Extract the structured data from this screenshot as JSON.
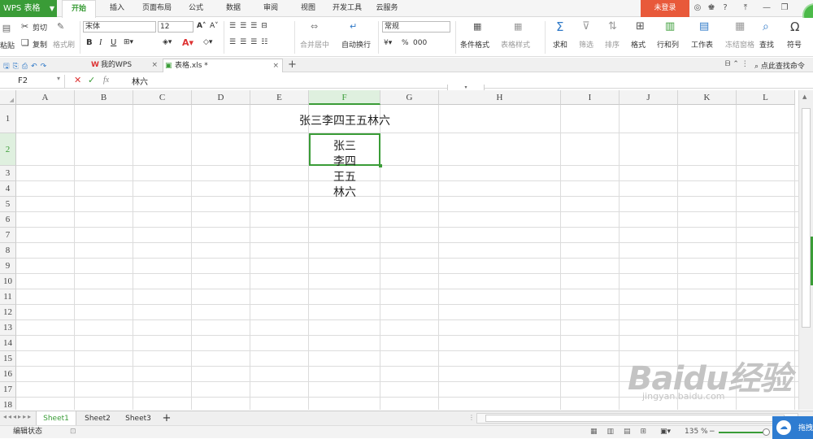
{
  "app": {
    "name": "WPS 表格"
  },
  "menu": {
    "tabs": [
      "开始",
      "插入",
      "页面布局",
      "公式",
      "数据",
      "审阅",
      "视图",
      "开发工具",
      "云服务"
    ],
    "active": "开始",
    "login": "未登录"
  },
  "ribbon": {
    "cut": "剪切",
    "copy": "复制",
    "format_painter": "格式刷",
    "paste": "粘贴",
    "font_name": "宋体",
    "font_size": "12",
    "merge_center": "合并居中",
    "wrap_text": "自动换行",
    "number_format": "常规",
    "percent": "%",
    "thousands": "000",
    "conditional_format": "条件格式",
    "table_style": "表格样式",
    "sum": "求和",
    "filter": "筛选",
    "sort": "排序",
    "format": "格式",
    "row_col": "行和列",
    "worksheet": "工作表",
    "freeze": "冻结窗格",
    "find": "查找",
    "symbol": "符号"
  },
  "doc_tabs": {
    "my_wps": "我的WPS",
    "file": "表格.xls *",
    "find_cmd": "点此查找命令"
  },
  "formula_bar": {
    "cell_ref": "F2",
    "fx": "fx",
    "value": "林六"
  },
  "columns": [
    "A",
    "B",
    "C",
    "D",
    "E",
    "F",
    "G",
    "H",
    "I",
    "J",
    "K",
    "L"
  ],
  "active_column": "F",
  "rows": [
    "1",
    "2",
    "3",
    "4",
    "5",
    "6",
    "7",
    "8",
    "9",
    "10",
    "11",
    "12",
    "13",
    "14",
    "15",
    "16",
    "17",
    "18"
  ],
  "active_row": "2",
  "cells": {
    "r1": "张三李四王五林六",
    "f2_lines": [
      "张三",
      "李四",
      "王五",
      "林六"
    ]
  },
  "sheets": [
    "Sheet1",
    "Sheet2",
    "Sheet3"
  ],
  "active_sheet": "Sheet1",
  "status": {
    "mode": "编辑状态",
    "zoom": "135 %",
    "drag": "拖拽"
  },
  "watermark": {
    "brand": "Baidu经验",
    "url": "jingyan.baidu.com"
  }
}
